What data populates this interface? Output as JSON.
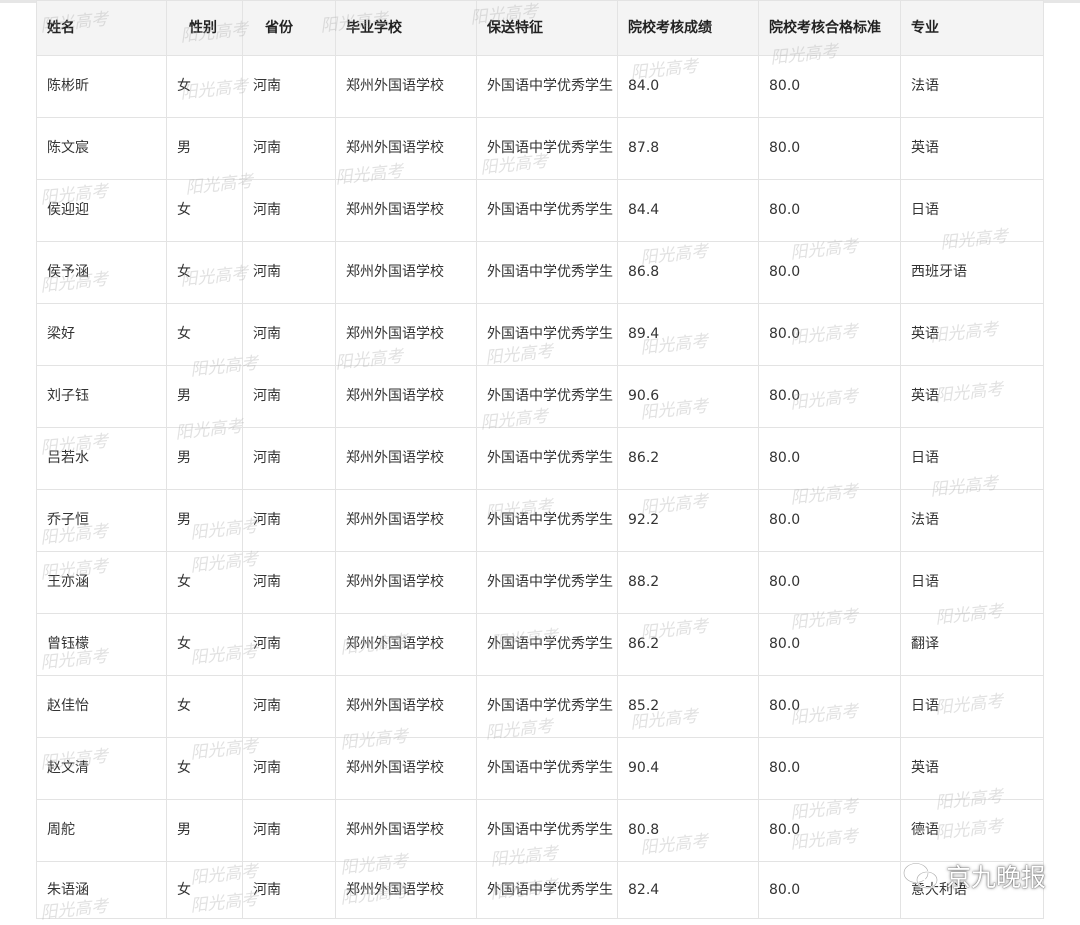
{
  "table": {
    "headers": [
      "姓名",
      "性别",
      "省份",
      "毕业学校",
      "保送特征",
      "院校考核成绩",
      "院校考核合格标准",
      "专业"
    ],
    "rows": [
      [
        "陈彬昕",
        "女",
        "河南",
        "郑州外国语学校",
        "外国语中学优秀学生",
        "84.0",
        "80.0",
        "法语"
      ],
      [
        "陈文宸",
        "男",
        "河南",
        "郑州外国语学校",
        "外国语中学优秀学生",
        "87.8",
        "80.0",
        "英语"
      ],
      [
        "侯迎迎",
        "女",
        "河南",
        "郑州外国语学校",
        "外国语中学优秀学生",
        "84.4",
        "80.0",
        "日语"
      ],
      [
        "侯予涵",
        "女",
        "河南",
        "郑州外国语学校",
        "外国语中学优秀学生",
        "86.8",
        "80.0",
        "西班牙语"
      ],
      [
        "梁好",
        "女",
        "河南",
        "郑州外国语学校",
        "外国语中学优秀学生",
        "89.4",
        "80.0",
        "英语"
      ],
      [
        "刘子钰",
        "男",
        "河南",
        "郑州外国语学校",
        "外国语中学优秀学生",
        "90.6",
        "80.0",
        "英语"
      ],
      [
        "吕若水",
        "男",
        "河南",
        "郑州外国语学校",
        "外国语中学优秀学生",
        "86.2",
        "80.0",
        "日语"
      ],
      [
        "乔子恒",
        "男",
        "河南",
        "郑州外国语学校",
        "外国语中学优秀学生",
        "92.2",
        "80.0",
        "法语"
      ],
      [
        "王亦涵",
        "女",
        "河南",
        "郑州外国语学校",
        "外国语中学优秀学生",
        "88.2",
        "80.0",
        "日语"
      ],
      [
        "曾钰檬",
        "女",
        "河南",
        "郑州外国语学校",
        "外国语中学优秀学生",
        "86.2",
        "80.0",
        "翻译"
      ],
      [
        "赵佳怡",
        "女",
        "河南",
        "郑州外国语学校",
        "外国语中学优秀学生",
        "85.2",
        "80.0",
        "日语"
      ],
      [
        "赵文清",
        "女",
        "河南",
        "郑州外国语学校",
        "外国语中学优秀学生",
        "90.4",
        "80.0",
        "英语"
      ],
      [
        "周舵",
        "男",
        "河南",
        "郑州外国语学校",
        "外国语中学优秀学生",
        "80.8",
        "80.0",
        "德语"
      ],
      [
        "朱语涵",
        "女",
        "河南",
        "郑州外国语学校",
        "外国语中学优秀学生",
        "82.4",
        "80.0",
        "意大利语"
      ]
    ]
  },
  "watermark": {
    "text": "阳光高考"
  },
  "brand": {
    "label": "京九晚报",
    "icon": "wechat-icon"
  }
}
